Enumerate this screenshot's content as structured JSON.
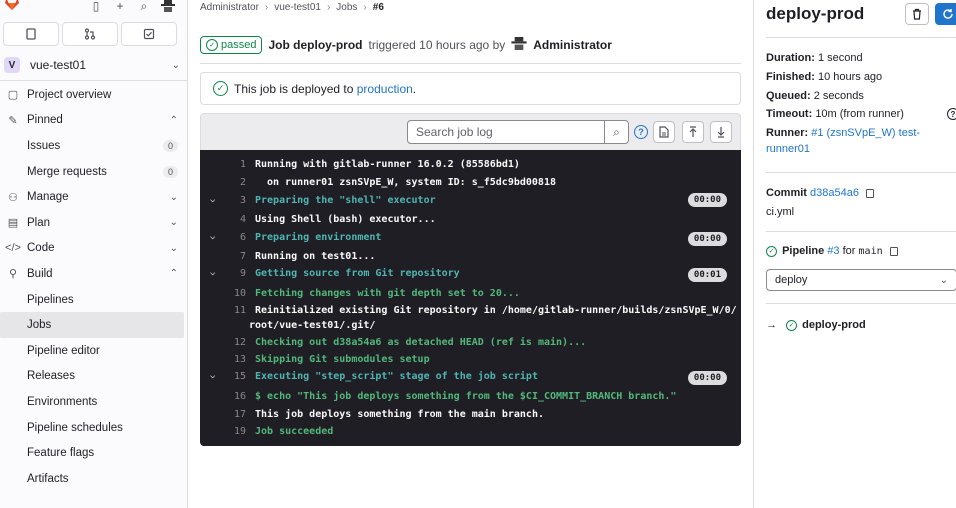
{
  "sidebar": {
    "project_initial": "V",
    "project_name": "vue-test01",
    "items": [
      {
        "label": "Project overview",
        "icon": "project-icon"
      },
      {
        "label": "Pinned",
        "icon": "pin-icon"
      },
      {
        "label": "Issues",
        "badge": "0"
      },
      {
        "label": "Merge requests",
        "badge": "0"
      },
      {
        "label": "Manage",
        "icon": "users-icon"
      },
      {
        "label": "Plan",
        "icon": "calendar-icon"
      },
      {
        "label": "Code",
        "icon": "code-icon"
      },
      {
        "label": "Build",
        "icon": "rocket-icon"
      },
      {
        "label": "Pipelines"
      },
      {
        "label": "Jobs"
      },
      {
        "label": "Pipeline editor"
      },
      {
        "label": "Releases"
      },
      {
        "label": "Environments"
      },
      {
        "label": "Pipeline schedules"
      },
      {
        "label": "Feature flags"
      },
      {
        "label": "Artifacts"
      }
    ]
  },
  "breadcrumb": {
    "items": [
      "Administrator",
      "vue-test01",
      "Jobs",
      "#6"
    ]
  },
  "header": {
    "status": "passed",
    "job_label": "Job deploy-prod",
    "triggered_text": "triggered 10 hours ago by",
    "user": "Administrator"
  },
  "deployment": {
    "text": "This job is deployed to",
    "env": "production",
    "period": "."
  },
  "log_toolbar": {
    "search_placeholder": "Search job log"
  },
  "log": [
    {
      "n": "1",
      "text": "Running with gitlab-runner 16.0.2 (85586bd1)",
      "style": "white"
    },
    {
      "n": "2",
      "text": "on runner01 zsnSVpE_W, system ID: s_f5dc9bd00818",
      "style": "white",
      "indent": true
    },
    {
      "n": "3",
      "text": "Preparing the \"shell\" executor",
      "style": "cyan",
      "section": true,
      "duration": "00:00"
    },
    {
      "n": "4",
      "text": "Using Shell (bash) executor...",
      "style": "white"
    },
    {
      "n": "6",
      "text": "Preparing environment",
      "style": "cyan",
      "section": true,
      "duration": "00:00"
    },
    {
      "n": "7",
      "text": "Running on test01...",
      "style": "white"
    },
    {
      "n": "9",
      "text": "Getting source from Git repository",
      "style": "cyan",
      "section": true,
      "duration": "00:01"
    },
    {
      "n": "10",
      "text": "Fetching changes with git depth set to 20...",
      "style": "green"
    },
    {
      "n": "11",
      "text": "Reinitialized existing Git repository in /home/gitlab-runner/builds/zsnSVpE_W/0/",
      "style": "white"
    },
    {
      "n": "",
      "text": "root/vue-test01/.git/",
      "style": "white",
      "wrap": true
    },
    {
      "n": "12",
      "text": "Checking out d38a54a6 as detached HEAD (ref is main)...",
      "style": "green"
    },
    {
      "n": "13",
      "text": "Skipping Git submodules setup",
      "style": "green"
    },
    {
      "n": "15",
      "text": "Executing \"step_script\" stage of the job script",
      "style": "cyan",
      "section": true,
      "duration": "00:00"
    },
    {
      "n": "16",
      "text": "$ echo \"This job deploys something from the $CI_COMMIT_BRANCH branch.\"",
      "style": "green"
    },
    {
      "n": "17",
      "text": "This job deploys something from the main branch.",
      "style": "white"
    },
    {
      "n": "19",
      "text": "Job succeeded",
      "style": "green"
    }
  ],
  "right_panel": {
    "title": "deploy-prod",
    "duration_label": "Duration:",
    "duration": "1 second",
    "finished_label": "Finished:",
    "finished": "10 hours ago",
    "queued_label": "Queued:",
    "queued": "2 seconds",
    "timeout_label": "Timeout:",
    "timeout": "10m (from runner)",
    "runner_label": "Runner:",
    "runner_line1": "#1 (zsnSVpE_W) test-",
    "runner_line2": "runner01",
    "commit_label": "Commit",
    "commit_sha": "d38a54a6",
    "commit_msg": "ci.yml",
    "pipeline_label": "Pipeline",
    "pipeline_id": "#3",
    "pipeline_for": "for",
    "pipeline_ref": "main",
    "stage_select": "deploy",
    "job_link": "deploy-prod"
  },
  "colors": {
    "success": "#108548",
    "link": "#1f75cb",
    "log_bg": "#1f1e24"
  }
}
